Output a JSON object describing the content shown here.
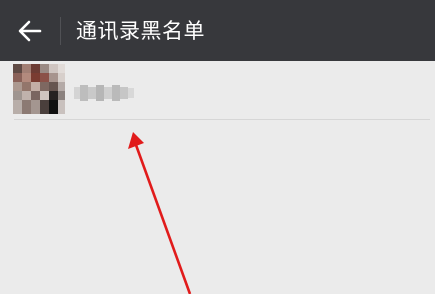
{
  "titlebar": {
    "back_icon": "arrow-left-icon",
    "title": "通讯录黑名单",
    "background": "#37383c"
  },
  "blacklist": {
    "items": [
      {
        "avatar": "pixelated-avatar",
        "name": ""
      }
    ]
  },
  "annotation": {
    "icon": "red-arrow-annotation",
    "color": "#e11b1b"
  }
}
